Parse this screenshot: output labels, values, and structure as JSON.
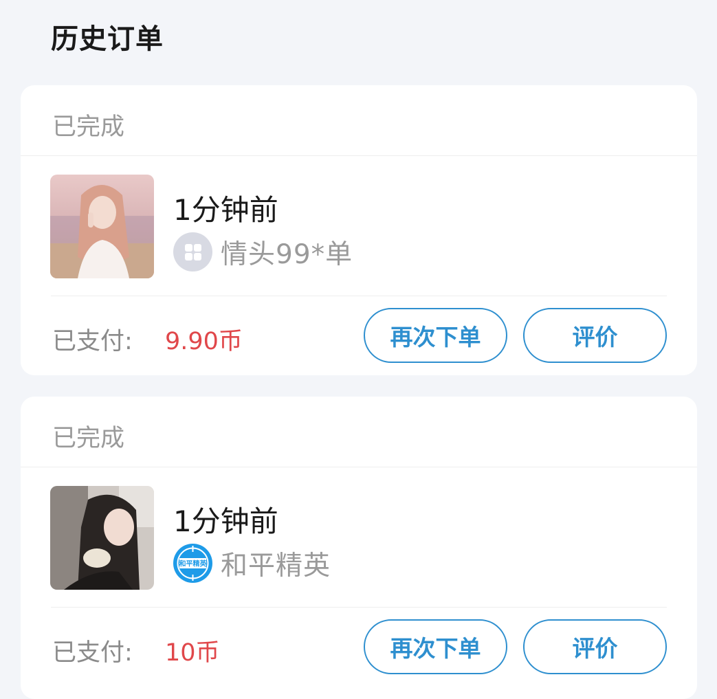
{
  "header": {
    "title": "历史订单"
  },
  "orders": [
    {
      "status": "已完成",
      "time": "1分钟前",
      "game": "情头99*单",
      "paid_label": "已支付:",
      "amount": "9.90币",
      "reorder_label": "再次下单",
      "review_label": "评价",
      "game_icon": "grid-app-icon"
    },
    {
      "status": "已完成",
      "time": "1分钟前",
      "game": "和平精英",
      "paid_label": "已支付:",
      "amount": "10币",
      "reorder_label": "再次下单",
      "review_label": "评价",
      "game_icon": "peace-elite-game-icon",
      "game_icon_text": "和平精英"
    }
  ],
  "colors": {
    "accent": "#2e8fcf",
    "price": "#e0474a",
    "background": "#f3f5f9"
  }
}
